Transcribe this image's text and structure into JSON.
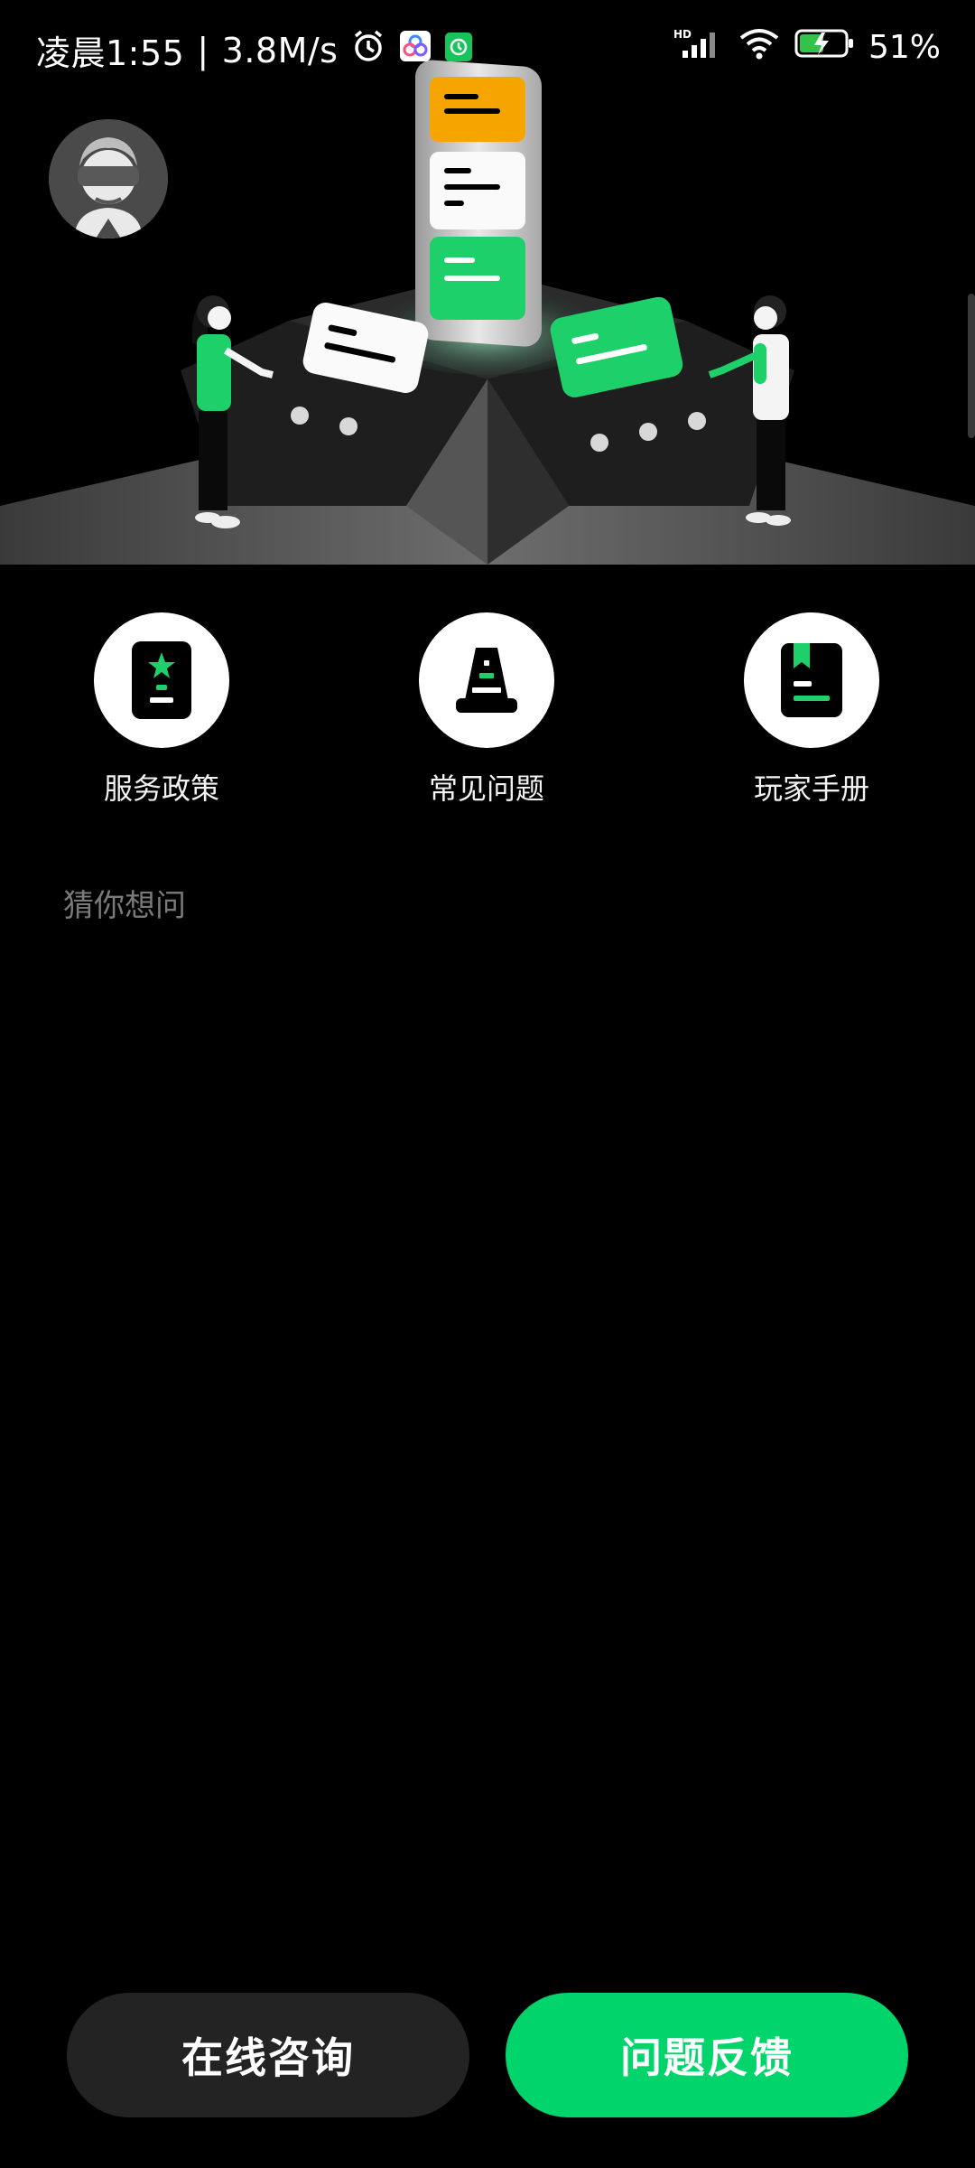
{
  "status_bar": {
    "time": "凌晨1:55",
    "network_speed": "3.8M/s",
    "battery": "51%",
    "signal_label": "HD"
  },
  "hero": {
    "avatar_icon": "vr-headset-user-icon"
  },
  "shortcuts": [
    {
      "label": "服务政策",
      "icon": "policy-phone-icon"
    },
    {
      "label": "常见问题",
      "icon": "traffic-cone-icon"
    },
    {
      "label": "玩家手册",
      "icon": "handbook-icon"
    }
  ],
  "section": {
    "title": "猜你想问"
  },
  "actions": {
    "consult_label": "在线咨询",
    "feedback_label": "问题反馈"
  },
  "colors": {
    "accent": "#00d46a",
    "background": "#000000",
    "secondary_button": "#232323",
    "highlight_orange": "#f5a400"
  }
}
